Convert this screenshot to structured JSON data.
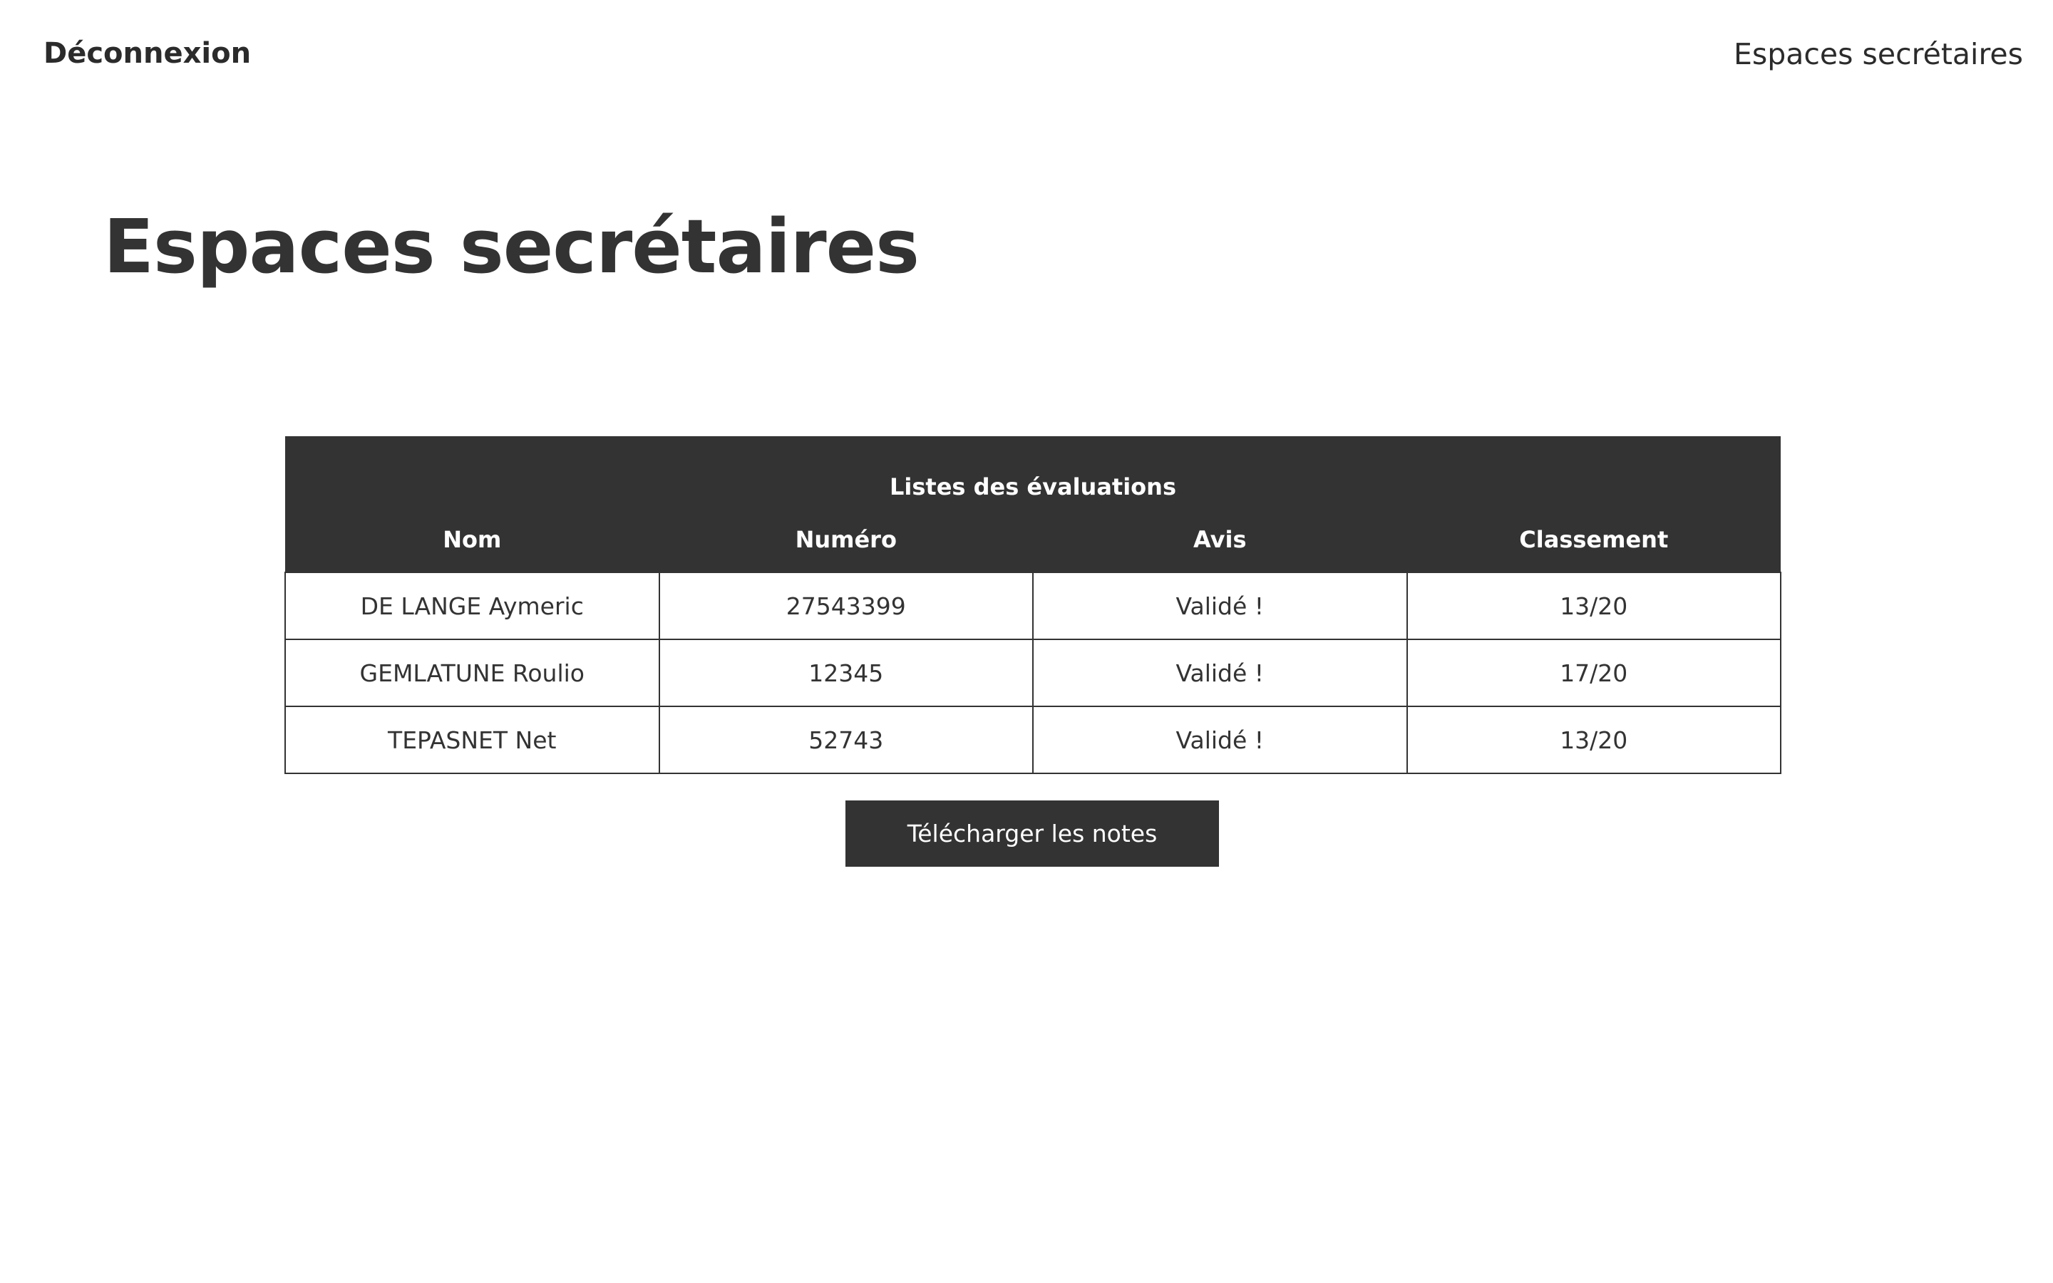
{
  "header": {
    "logout_label": "Déconnexion",
    "site_name": "Espaces secrétaires"
  },
  "main": {
    "title": "Espaces secrétaires",
    "table": {
      "caption": "Listes des évaluations",
      "columns": [
        "Nom",
        "Numéro",
        "Avis",
        "Classement"
      ],
      "rows": [
        [
          "DE LANGE Aymeric",
          "27543399",
          "Validé !",
          "13/20"
        ],
        [
          "GEMLATUNE Roulio",
          "12345",
          "Validé !",
          "17/20"
        ],
        [
          "TEPASNET Net",
          "52743",
          "Validé !",
          "13/20"
        ]
      ]
    },
    "download_button": "Télécharger les notes"
  },
  "colors": {
    "dark": "#333333",
    "background": "#ffffff",
    "header_text": "#ffffff"
  }
}
